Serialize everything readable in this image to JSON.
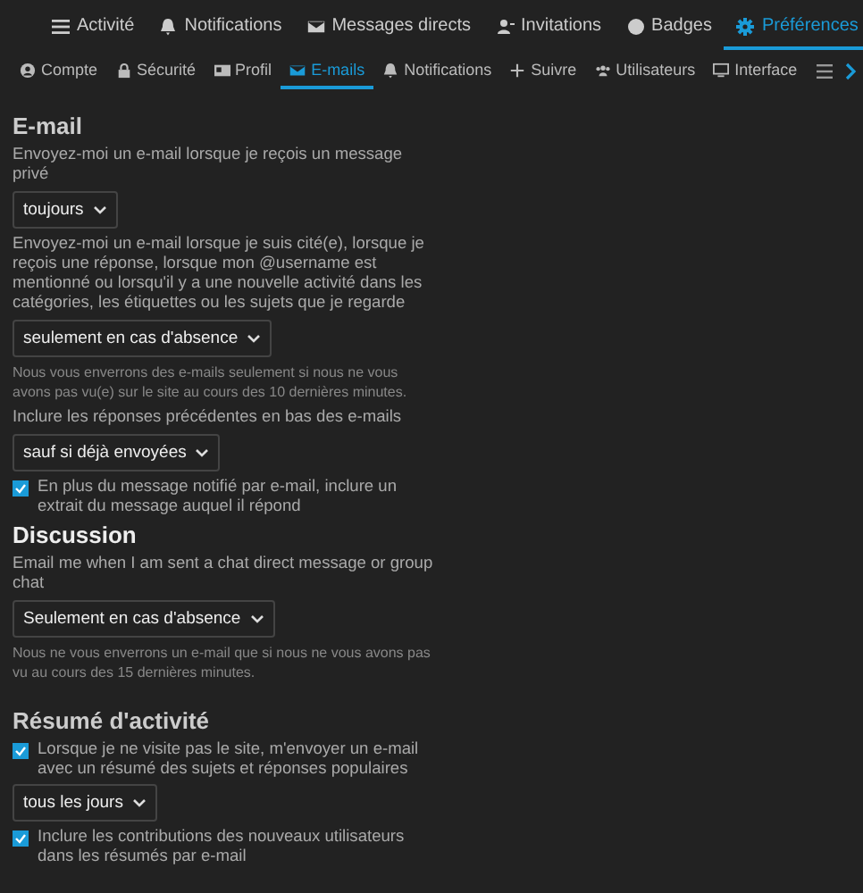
{
  "main_tabs": [
    {
      "label": "Activité",
      "selected": false
    },
    {
      "label": "Notifications",
      "selected": false
    },
    {
      "label": "Messages directs",
      "selected": false
    },
    {
      "label": "Invitations",
      "selected": false
    },
    {
      "label": "Badges",
      "selected": false
    },
    {
      "label": "Préférences",
      "selected": true
    }
  ],
  "sub_tabs": [
    {
      "label": "Compte",
      "selected": false
    },
    {
      "label": "Sécurité",
      "selected": false
    },
    {
      "label": "Profil",
      "selected": false
    },
    {
      "label": "E-mails",
      "selected": true
    },
    {
      "label": "Notifications",
      "selected": false
    },
    {
      "label": "Suivre",
      "selected": false
    },
    {
      "label": "Utilisateurs",
      "selected": false
    },
    {
      "label": "Interface",
      "selected": false
    }
  ],
  "sections": [
    {
      "heading": "E-mail",
      "items": [
        {
          "kind": "label",
          "text": "Envoyez-moi un e-mail lorsque je reçois un message privé"
        },
        {
          "kind": "select",
          "value": "toujours"
        },
        {
          "kind": "label",
          "text": "Envoyez-moi un e-mail lorsque je suis cité(e), lorsque je reçois une réponse, lorsque mon @username est mentionné ou lorsqu'il y a une nouvelle activité dans les catégories, les étiquettes ou les sujets que je regarde"
        },
        {
          "kind": "select",
          "value": "seulement en cas d'absence"
        },
        {
          "kind": "hint",
          "text": "Nous vous enverrons des e-mails seulement si nous ne vous avons pas vu(e) sur le site au cours des 10 dernières minutes."
        },
        {
          "kind": "label",
          "text": "Inclure les réponses précédentes en bas des e-mails"
        },
        {
          "kind": "select",
          "value": "sauf si déjà envoyées"
        },
        {
          "kind": "checkbox",
          "checked": true,
          "text": "En plus du message notifié par e-mail, inclure un extrait du message auquel il répond"
        }
      ]
    },
    {
      "heading": "Discussion",
      "items": [
        {
          "kind": "label",
          "text": "Email me when I am sent a chat direct message or group chat"
        },
        {
          "kind": "select",
          "value": "Seulement en cas d'absence"
        },
        {
          "kind": "hint",
          "text": "Nous ne vous enverrons un e-mail que si nous ne vous avons pas vu au cours des 15 dernières minutes."
        }
      ]
    },
    {
      "heading": "Résumé d'activité",
      "items": [
        {
          "kind": "checkbox",
          "checked": true,
          "text": "Lorsque je ne visite pas le site, m'envoyer un e-mail avec un résumé des sujets et réponses populaires"
        },
        {
          "kind": "select",
          "value": "tous les jours"
        },
        {
          "kind": "checkbox",
          "checked": true,
          "text": "Inclure les contributions des nouveaux utilisateurs dans les résumés par e-mail"
        }
      ]
    }
  ]
}
